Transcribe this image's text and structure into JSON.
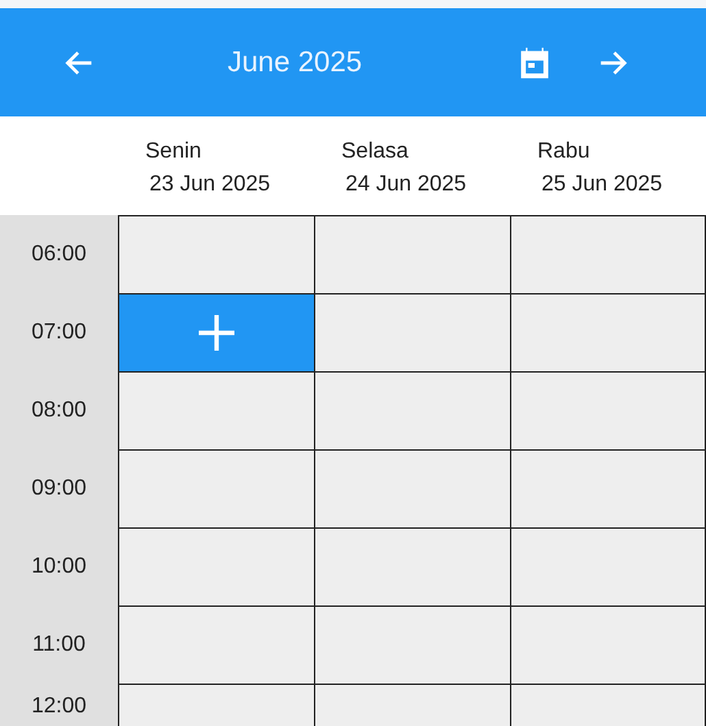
{
  "header": {
    "title": "June 2025"
  },
  "days": [
    {
      "name": "Senin",
      "date": "23 Jun 2025"
    },
    {
      "name": "Selasa",
      "date": "24 Jun 2025"
    },
    {
      "name": "Rabu",
      "date": "25 Jun 2025"
    }
  ],
  "rows": [
    {
      "time": "06:00",
      "cells": [
        {
          "selected": false
        },
        {
          "selected": false
        },
        {
          "selected": false
        }
      ]
    },
    {
      "time": "07:00",
      "cells": [
        {
          "selected": true
        },
        {
          "selected": false
        },
        {
          "selected": false
        }
      ]
    },
    {
      "time": "08:00",
      "cells": [
        {
          "selected": false
        },
        {
          "selected": false
        },
        {
          "selected": false
        }
      ]
    },
    {
      "time": "09:00",
      "cells": [
        {
          "selected": false
        },
        {
          "selected": false
        },
        {
          "selected": false
        }
      ]
    },
    {
      "time": "10:00",
      "cells": [
        {
          "selected": false
        },
        {
          "selected": false
        },
        {
          "selected": false
        }
      ]
    },
    {
      "time": "11:00",
      "cells": [
        {
          "selected": false
        },
        {
          "selected": false
        },
        {
          "selected": false
        }
      ]
    },
    {
      "time": "12:00",
      "cells": [
        {
          "selected": false
        },
        {
          "selected": false
        },
        {
          "selected": false
        }
      ]
    }
  ]
}
